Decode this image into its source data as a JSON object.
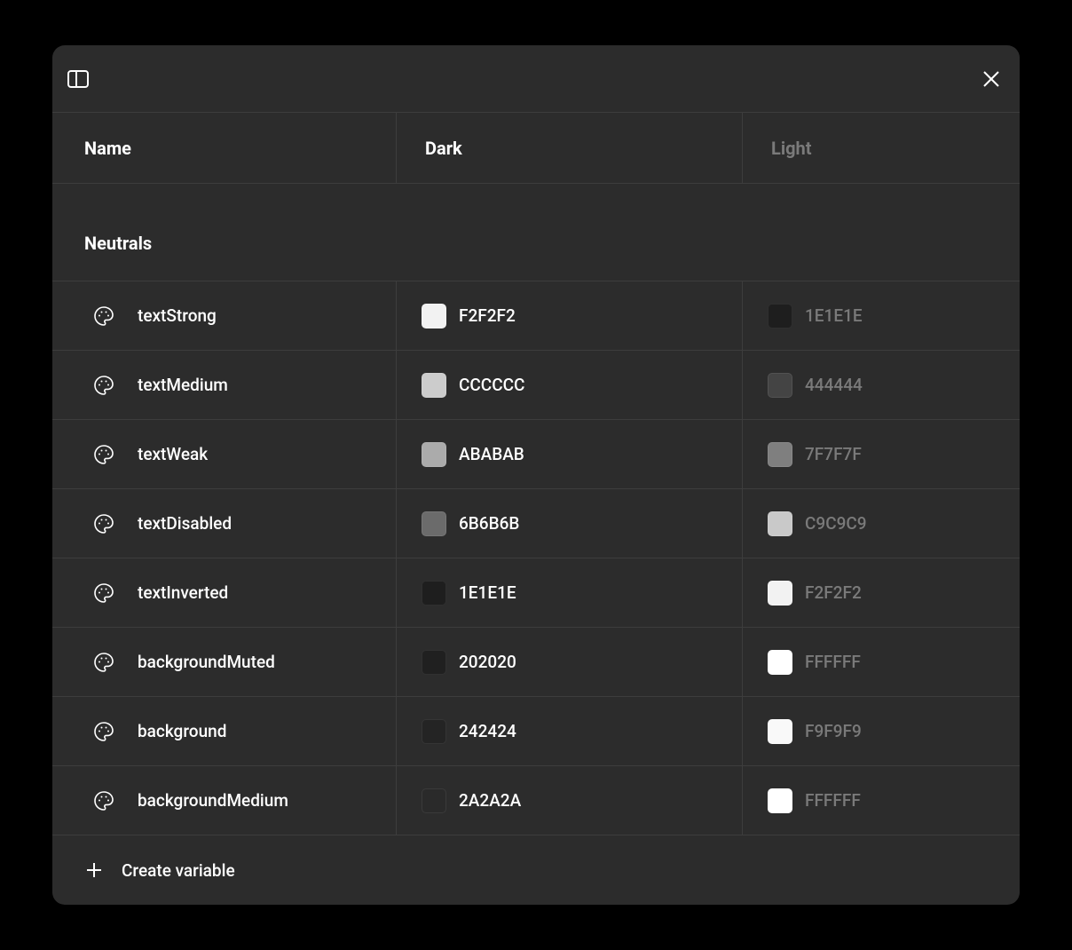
{
  "headers": {
    "name": "Name",
    "dark": "Dark",
    "light": "Light"
  },
  "group": {
    "title": "Neutrals"
  },
  "variables": [
    {
      "name": "textStrong",
      "dark": {
        "hex": "F2F2F2",
        "swatch": "#F2F2F2"
      },
      "light": {
        "hex": "1E1E1E",
        "swatch": "#1E1E1E"
      }
    },
    {
      "name": "textMedium",
      "dark": {
        "hex": "CCCCCC",
        "swatch": "#CCCCCC"
      },
      "light": {
        "hex": "444444",
        "swatch": "#444444"
      }
    },
    {
      "name": "textWeak",
      "dark": {
        "hex": "ABABAB",
        "swatch": "#ABABAB"
      },
      "light": {
        "hex": "7F7F7F",
        "swatch": "#7F7F7F"
      }
    },
    {
      "name": "textDisabled",
      "dark": {
        "hex": "6B6B6B",
        "swatch": "#6B6B6B"
      },
      "light": {
        "hex": "C9C9C9",
        "swatch": "#C9C9C9"
      }
    },
    {
      "name": "textInverted",
      "dark": {
        "hex": "1E1E1E",
        "swatch": "#1E1E1E"
      },
      "light": {
        "hex": "F2F2F2",
        "swatch": "#F2F2F2"
      }
    },
    {
      "name": "backgroundMuted",
      "dark": {
        "hex": "202020",
        "swatch": "#202020"
      },
      "light": {
        "hex": "FFFFFF",
        "swatch": "#FFFFFF"
      }
    },
    {
      "name": "background",
      "dark": {
        "hex": "242424",
        "swatch": "#242424"
      },
      "light": {
        "hex": "F9F9F9",
        "swatch": "#F9F9F9"
      }
    },
    {
      "name": "backgroundMedium",
      "dark": {
        "hex": "2A2A2A",
        "swatch": "#2A2A2A"
      },
      "light": {
        "hex": "FFFFFF",
        "swatch": "#FFFFFF"
      }
    }
  ],
  "footer": {
    "create_label": "Create variable"
  }
}
